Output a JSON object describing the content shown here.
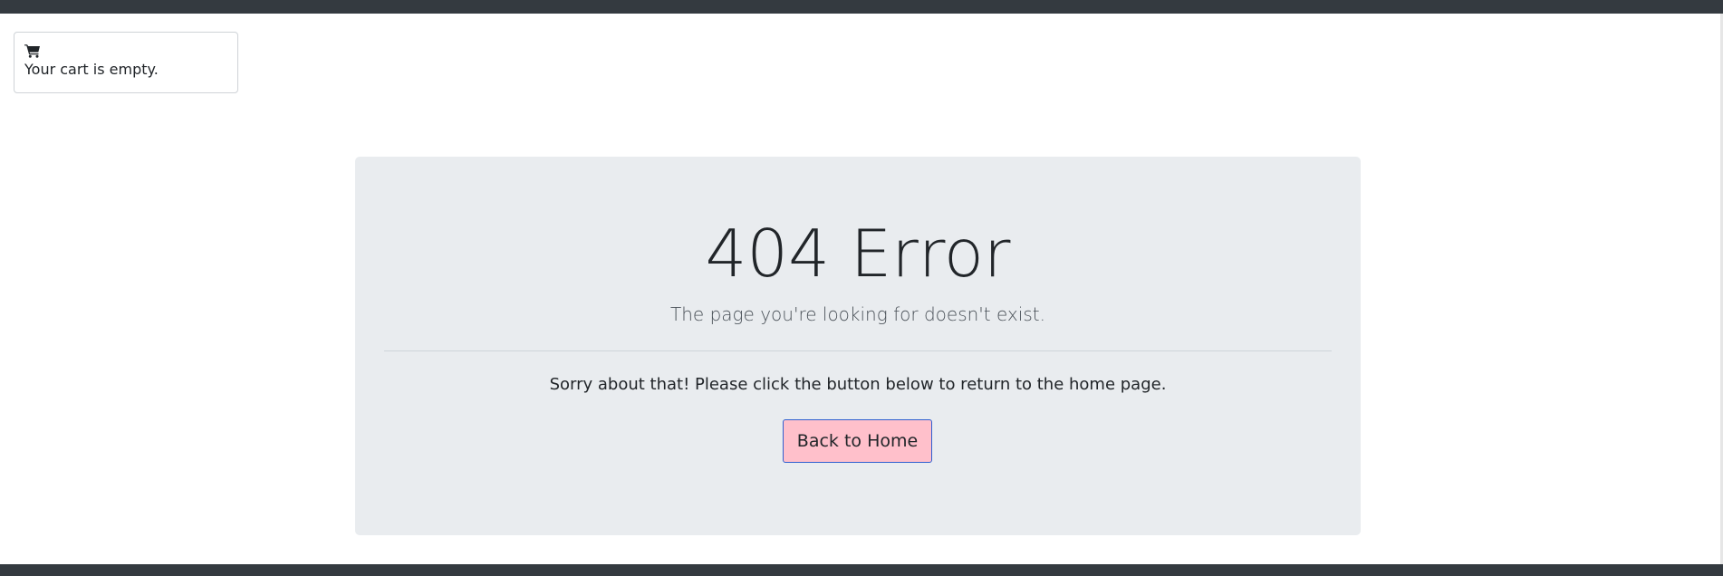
{
  "cart": {
    "icon": "shopping-cart-icon",
    "empty_text": "Your cart is empty."
  },
  "error": {
    "title": "404 Error",
    "lead": "The page you're looking for doesn't exist.",
    "message": "Sorry about that! Please click the button below to return to the home page.",
    "button_label": "Back to Home"
  },
  "colors": {
    "nav_bar": "#343a40",
    "panel_background": "#e9ecef",
    "button_background": "#ffc0cb",
    "button_border": "#2f5fd0"
  }
}
